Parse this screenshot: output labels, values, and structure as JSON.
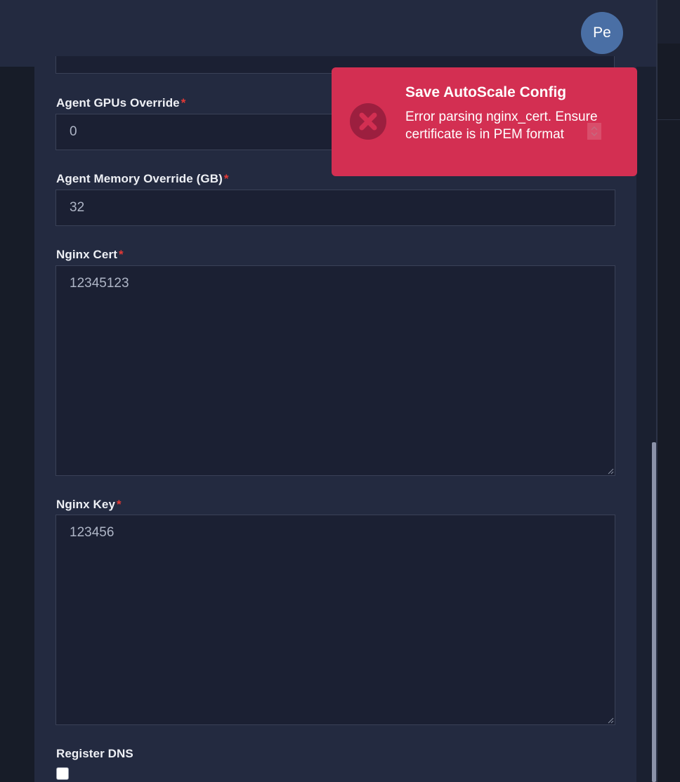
{
  "header": {
    "avatar_initials": "Pe"
  },
  "form": {
    "gpus": {
      "label": "Agent GPUs Override",
      "required_mark": "*",
      "value": "0"
    },
    "memory": {
      "label": "Agent Memory Override (GB)",
      "required_mark": "*",
      "value": "32"
    },
    "nginx_cert": {
      "label": "Nginx Cert",
      "required_mark": "*",
      "value": "12345123"
    },
    "nginx_key": {
      "label": "Nginx Key",
      "required_mark": "*",
      "value": "123456"
    },
    "register_dns": {
      "label": "Register DNS",
      "checked": false
    }
  },
  "toast": {
    "title": "Save AutoScale Config",
    "message": "Error parsing nginx_cert. Ensure certificate is in PEM format",
    "icon": "error-x-circle-icon",
    "color": "#d32f52"
  },
  "colors": {
    "required": "#e53935",
    "panel": "#232a40",
    "field_bg": "#1b2033"
  }
}
